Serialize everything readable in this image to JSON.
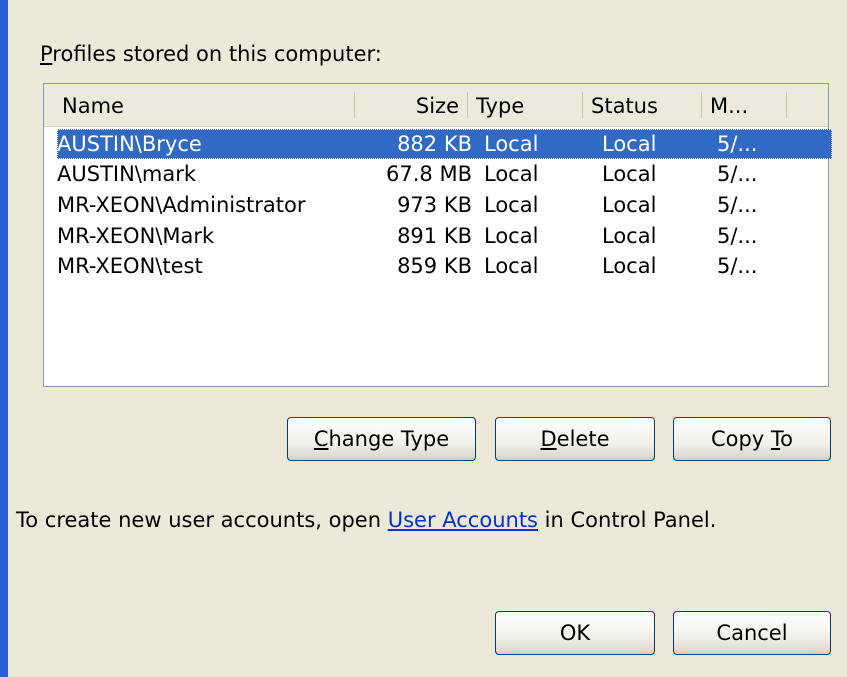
{
  "profiles_label": {
    "accel": "P",
    "rest": "rofiles stored on this computer:"
  },
  "columns": [
    "Name",
    "Size",
    "Type",
    "Status",
    "M..."
  ],
  "rows": [
    {
      "name": "AUSTIN\\Bryce",
      "size": "882 KB",
      "type": "Local",
      "status": "Local",
      "modified": "5/...",
      "selected": true
    },
    {
      "name": "AUSTIN\\mark",
      "size": "67.8 MB",
      "type": "Local",
      "status": "Local",
      "modified": "5/..."
    },
    {
      "name": "MR-XEON\\Administrator",
      "size": "973 KB",
      "type": "Local",
      "status": "Local",
      "modified": "5/..."
    },
    {
      "name": "MR-XEON\\Mark",
      "size": "891 KB",
      "type": "Local",
      "status": "Local",
      "modified": "5/..."
    },
    {
      "name": "MR-XEON\\test",
      "size": "859 KB",
      "type": "Local",
      "status": "Local",
      "modified": "5/..."
    }
  ],
  "buttons": {
    "change_type": {
      "accel": "C",
      "rest": "hange Type"
    },
    "delete": {
      "accel": "D",
      "rest": "elete"
    },
    "copy_to": {
      "pre": "Copy ",
      "accel": "T",
      "rest": "o"
    },
    "ok": "OK",
    "cancel": "Cancel"
  },
  "hint": {
    "before": "To create new user accounts, open ",
    "link": "User Accounts",
    "after": " in Control Panel."
  },
  "colors": {
    "selection": "#316ac5",
    "link": "#0033cc",
    "accent_bar": "#2a5dd8"
  }
}
